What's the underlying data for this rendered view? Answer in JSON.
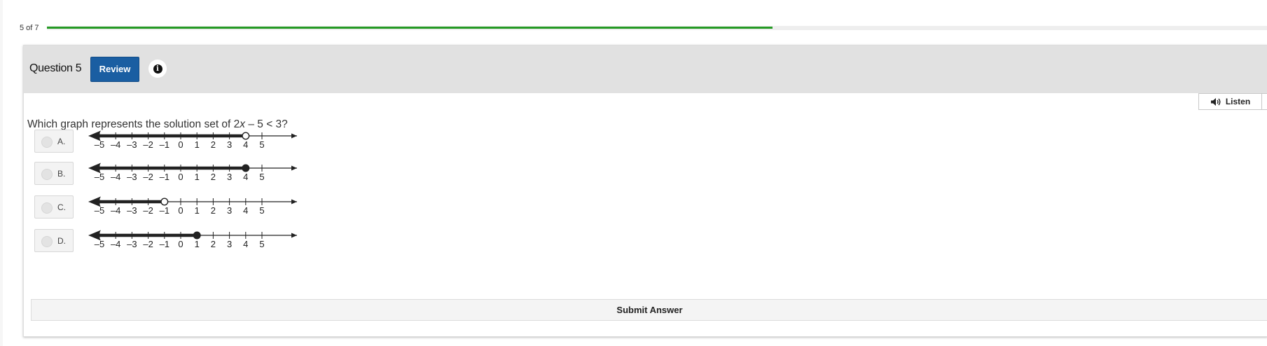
{
  "progress": {
    "label": "5 of 7",
    "fraction": 0.595
  },
  "header": {
    "question_title": "Question 5",
    "review_label": "Review",
    "info_icon": "info-circle-icon",
    "info_glyph": "i"
  },
  "listen": {
    "label": "Listen",
    "icon": "speaker-icon"
  },
  "question": {
    "prefix": "Which graph represents the solution set of 2",
    "variable": "x",
    "suffix": " – 5 < 3?"
  },
  "tick_labels": [
    "–5",
    "–4",
    "–3",
    "–2",
    "–1",
    "0",
    "1",
    "2",
    "3",
    "4",
    "5"
  ],
  "options": [
    {
      "letter": "A.",
      "point": 4,
      "closed": false,
      "shade": "left"
    },
    {
      "letter": "B.",
      "point": 4,
      "closed": true,
      "shade": "left"
    },
    {
      "letter": "C.",
      "point": -1,
      "closed": false,
      "shade": "left"
    },
    {
      "letter": "D.",
      "point": 1,
      "closed": true,
      "shade": "left"
    }
  ],
  "submit": {
    "label": "Submit Answer"
  },
  "colors": {
    "progress": "#259a24",
    "review_button": "#1a5ea2",
    "header_bg": "#e1e1e1"
  }
}
